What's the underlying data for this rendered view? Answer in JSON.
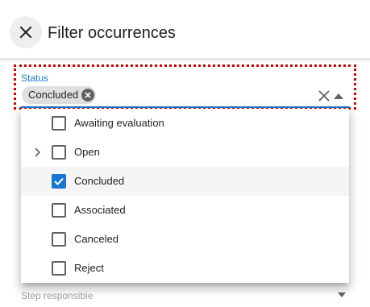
{
  "header": {
    "title": "Filter occurrences",
    "close_icon": "close-icon"
  },
  "status_field": {
    "label": "Status",
    "chips": [
      {
        "label": "Concluded"
      }
    ],
    "clear_icon": "close-icon",
    "toggle_icon": "arrow-up-icon",
    "accent_color": "#1976d2",
    "focus_outline_color": "#d50000"
  },
  "options": [
    {
      "label": "Awaiting evaluation",
      "checked": false,
      "expandable": false
    },
    {
      "label": "Open",
      "checked": false,
      "expandable": true
    },
    {
      "label": "Concluded",
      "checked": true,
      "expandable": false
    },
    {
      "label": "Associated",
      "checked": false,
      "expandable": false
    },
    {
      "label": "Canceled",
      "checked": false,
      "expandable": false
    },
    {
      "label": "Reject",
      "checked": false,
      "expandable": false
    }
  ],
  "next_field": {
    "label": "Step responsible",
    "toggle_icon": "arrow-down-icon"
  }
}
